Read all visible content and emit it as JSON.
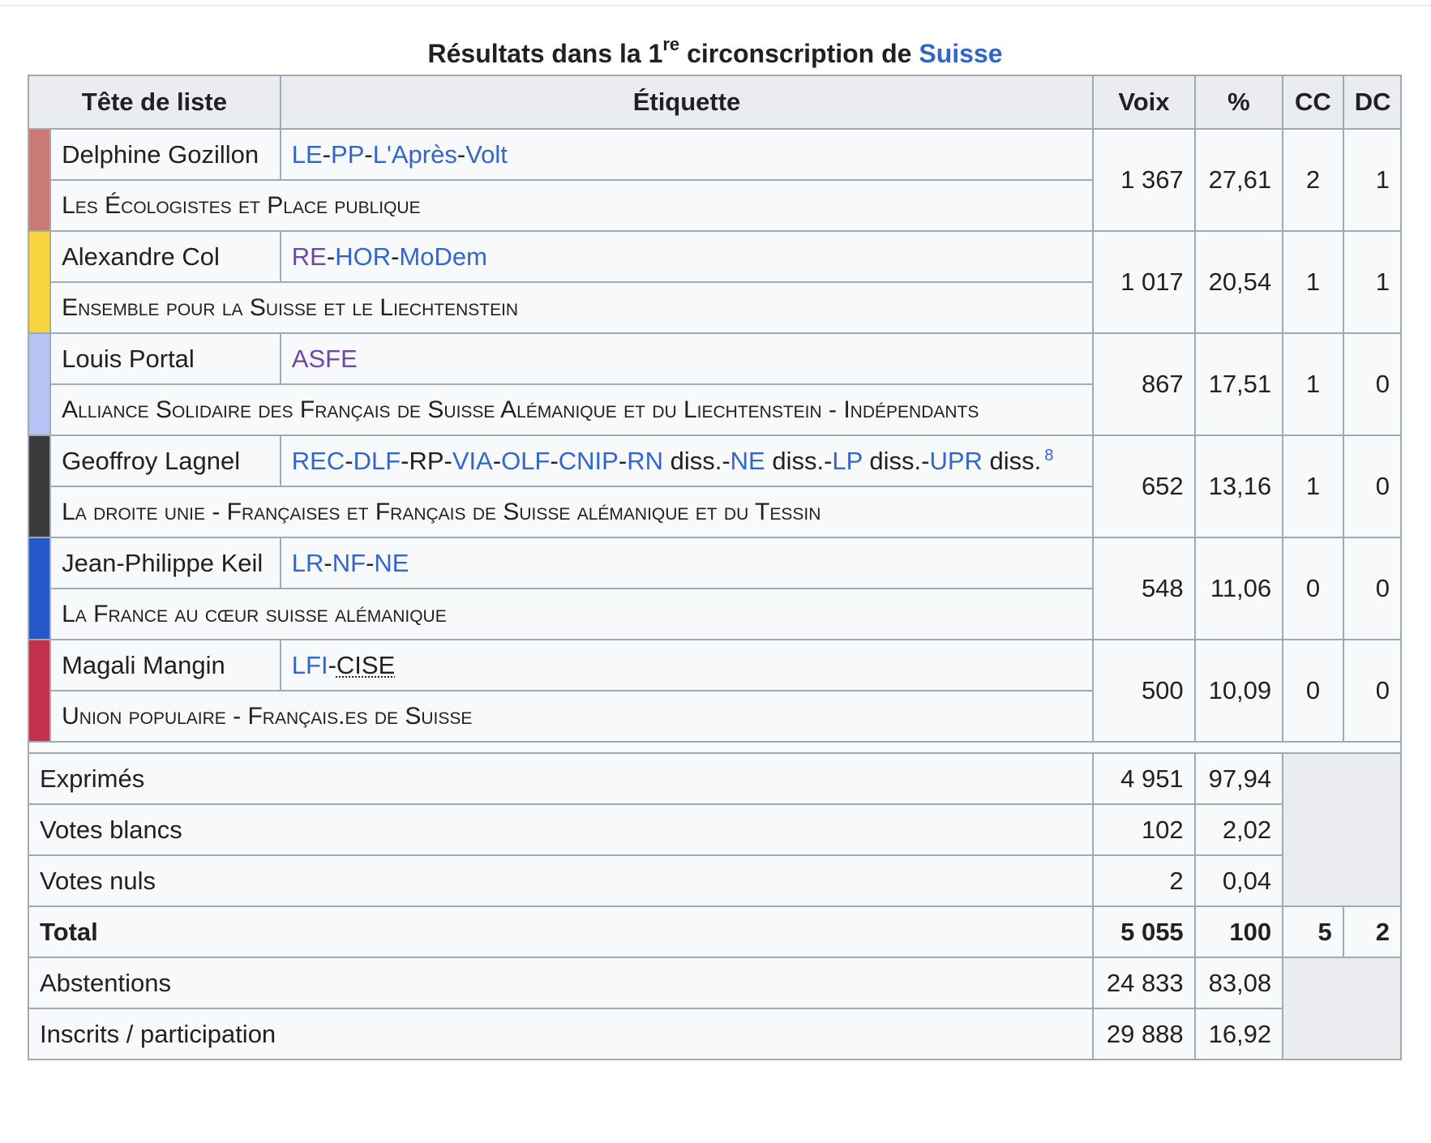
{
  "caption": {
    "prefix": "Résultats dans la 1",
    "ordinal": "re",
    "middle": " circonscription de ",
    "link": "Suisse"
  },
  "headers": {
    "candidate": "Tête de liste",
    "label": "Étiquette",
    "votes": "Voix",
    "pct": "%",
    "cc": "CC",
    "dc": "DC"
  },
  "rows": [
    {
      "color": "#c97a74",
      "candidate": "Delphine Gozillon",
      "parties": [
        {
          "t": "LE",
          "c": "link"
        },
        {
          "t": "-",
          "c": ""
        },
        {
          "t": "PP",
          "c": "link"
        },
        {
          "t": "-",
          "c": ""
        },
        {
          "t": "L'Après",
          "c": "link"
        },
        {
          "t": "-",
          "c": ""
        },
        {
          "t": "Volt",
          "c": "link"
        }
      ],
      "list": "Les Écologistes et Place publique",
      "votes": "1 367",
      "pct": "27,61",
      "cc": "2",
      "dc": "1"
    },
    {
      "color": "#f7d33e",
      "candidate": "Alexandre Col",
      "parties": [
        {
          "t": "RE",
          "c": "visited"
        },
        {
          "t": "-",
          "c": ""
        },
        {
          "t": "HOR",
          "c": "link"
        },
        {
          "t": "-",
          "c": ""
        },
        {
          "t": "MoDem",
          "c": "link"
        }
      ],
      "list": "Ensemble pour la Suisse et le Liechtenstein",
      "votes": "1 017",
      "pct": "20,54",
      "cc": "1",
      "dc": "1"
    },
    {
      "color": "#b8c3f5",
      "candidate": "Louis Portal",
      "parties": [
        {
          "t": "ASFE",
          "c": "visited"
        }
      ],
      "list": "Alliance Solidaire des Français de Suisse Alémanique et du Liechtenstein - Indépendants",
      "votes": "867",
      "pct": "17,51",
      "cc": "1",
      "dc": "0"
    },
    {
      "color": "#3a3a3a",
      "candidate": "Geoffroy Lagnel",
      "parties": [
        {
          "t": "REC",
          "c": "link"
        },
        {
          "t": "-",
          "c": ""
        },
        {
          "t": "DLF",
          "c": "link"
        },
        {
          "t": "-RP-",
          "c": ""
        },
        {
          "t": "VIA",
          "c": "link"
        },
        {
          "t": "-",
          "c": ""
        },
        {
          "t": "OLF",
          "c": "link"
        },
        {
          "t": "-",
          "c": ""
        },
        {
          "t": "CNIP",
          "c": "link"
        },
        {
          "t": "-",
          "c": ""
        },
        {
          "t": "RN",
          "c": "link"
        },
        {
          "t": " diss.-",
          "c": ""
        },
        {
          "t": "NE",
          "c": "link"
        },
        {
          "t": " diss.-",
          "c": ""
        },
        {
          "t": "LP",
          "c": "link"
        },
        {
          "t": " diss.-",
          "c": ""
        },
        {
          "t": "UPR",
          "c": "link"
        },
        {
          "t": " diss.",
          "c": ""
        }
      ],
      "ref": "8",
      "list": "La droite unie - Françaises et Français de Suisse alémanique et du Tessin",
      "votes": "652",
      "pct": "13,16",
      "cc": "1",
      "dc": "0"
    },
    {
      "color": "#2457c8",
      "candidate": "Jean-Philippe Keil",
      "parties": [
        {
          "t": "LR",
          "c": "link"
        },
        {
          "t": "-",
          "c": ""
        },
        {
          "t": "NF",
          "c": "link"
        },
        {
          "t": "-",
          "c": ""
        },
        {
          "t": "NE",
          "c": "link"
        }
      ],
      "list": "La France au cœur suisse alémanique",
      "votes": "548",
      "pct": "11,06",
      "cc": "0",
      "dc": "0"
    },
    {
      "color": "#c3314a",
      "candidate": "Magali Mangin",
      "parties": [
        {
          "t": "LFI",
          "c": "link"
        },
        {
          "t": "-",
          "c": ""
        },
        {
          "t": "CISE",
          "c": "abbr"
        }
      ],
      "list": "Union populaire - Français.es de Suisse",
      "votes": "500",
      "pct": "10,09",
      "cc": "0",
      "dc": "0"
    }
  ],
  "summary": {
    "expressed": {
      "label": "Exprimés",
      "votes": "4 951",
      "pct": "97,94"
    },
    "blank": {
      "label": "Votes blancs",
      "votes": "102",
      "pct": "2,02"
    },
    "null": {
      "label": "Votes nuls",
      "votes": "2",
      "pct": "0,04"
    },
    "total": {
      "label": "Total",
      "votes": "5 055",
      "pct": "100",
      "cc": "5",
      "dc": "2"
    },
    "abstentions": {
      "label": "Abstentions",
      "votes": "24 833",
      "pct": "83,08"
    },
    "registered": {
      "label": "Inscrits / participation",
      "votes": "29 888",
      "pct": "16,92"
    }
  }
}
